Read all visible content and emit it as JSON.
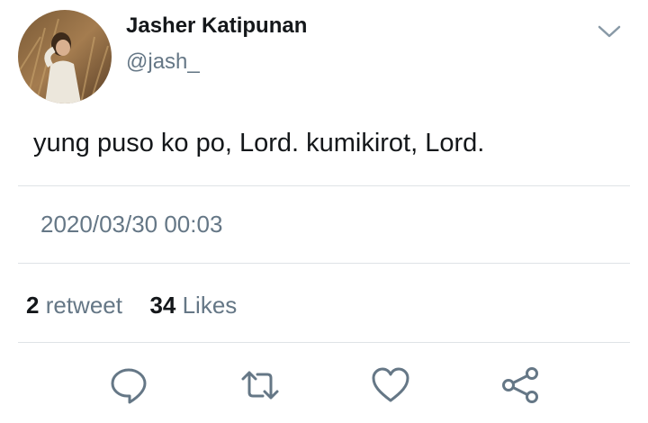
{
  "tweet": {
    "display_name": "Jasher Katipunan",
    "handle": "@jash_",
    "text": "yung puso ko po, Lord. kumikirot, Lord.",
    "timestamp": "2020/03/30 00:03",
    "retweet_count": "2",
    "retweet_label": "retweet",
    "like_count": "34",
    "like_label": "Likes"
  },
  "icons": {
    "menu": "chevron-down-icon",
    "reply": "reply-icon",
    "retweet": "retweet-icon",
    "like": "heart-icon",
    "share": "share-icon"
  },
  "colors": {
    "text_primary": "#14171a",
    "text_secondary": "#657786",
    "icon": "#657786",
    "divider": "#dfe3e6"
  }
}
